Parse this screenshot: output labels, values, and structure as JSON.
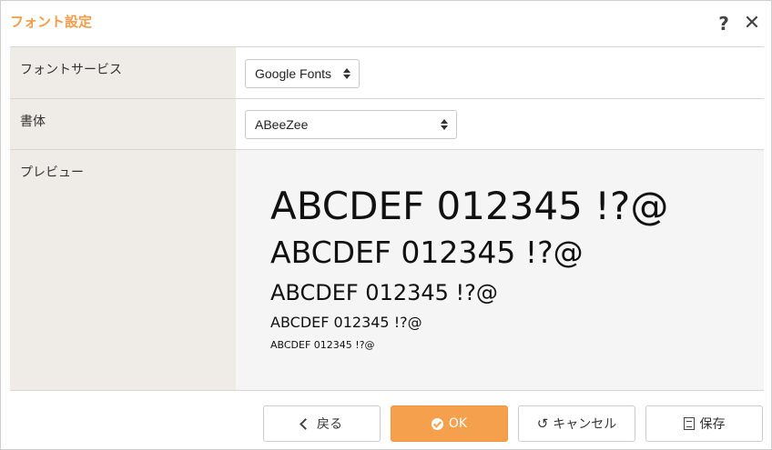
{
  "dialog": {
    "title": "フォント設定",
    "help_icon": "?",
    "close_icon": "✕"
  },
  "fields": {
    "font_service": {
      "label": "フォントサービス",
      "value": "Google Fonts"
    },
    "typeface": {
      "label": "書体",
      "value": "ABeeZee"
    },
    "preview": {
      "label": "プレビュー",
      "sample_text": "ABCDEF 012345 !?@"
    }
  },
  "footer": {
    "back_label": "戻る",
    "ok_label": "OK",
    "cancel_label": "キャンセル",
    "save_label": "保存"
  },
  "colors": {
    "accent": "#f5a04d",
    "title": "#f39c4a",
    "label_bg": "#efebe6",
    "preview_bg": "#f5f5f5"
  }
}
